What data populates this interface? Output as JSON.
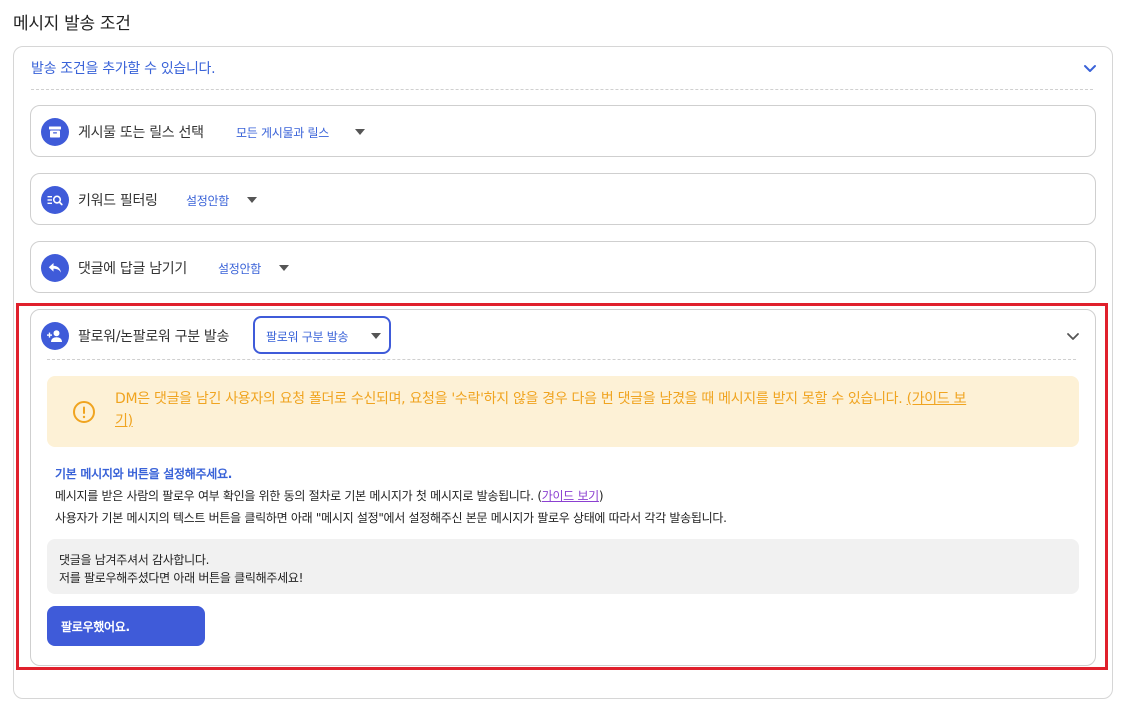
{
  "page_title": "메시지 발송 조건",
  "add_condition": {
    "label": "발송 조건을 추가할 수 있습니다."
  },
  "conditions": [
    {
      "title": "게시물 또는 릴스 선택",
      "value": "모든 게시물과 릴스",
      "icon": "archive-box-icon"
    },
    {
      "title": "키워드 필터링",
      "value": "설정안함",
      "icon": "keyword-search-icon"
    },
    {
      "title": "댓글에 답글 남기기",
      "value": "설정안함",
      "icon": "reply-arrow-icon"
    }
  ],
  "follower_section": {
    "title": "팔로워/논팔로워 구분 발송",
    "select_value": "팔로워 구분 발송",
    "icon": "person-add-icon",
    "warning": {
      "text": "DM은 댓글을 남긴 사용자의 요청 폴더로 수신되며, 요청을 '수락'하지 않을 경우 다음 번 댓글을 남겼을 때 메시지를 받지 못할 수 있습니다. ",
      "link_part1": "(가이드 보",
      "link_part2": "기)"
    },
    "info": {
      "title": "기본 메시지와 버튼을 설정해주세요.",
      "line1_prefix": "메시지를 받은 사람의 팔로우 여부 확인을 위한 동의 절차로 기본 메시지가 첫 메시지로 발송됩니다. (",
      "line1_link": "가이드 보기",
      "line1_suffix": ")",
      "line2": "사용자가 기본 메시지의 텍스트 버튼을 클릭하면 아래 \"메시지 설정\"에서 설정해주신 본문 메시지가 팔로우 상태에 따라서 각각 발송됩니다."
    },
    "message_lines": [
      "댓글을 남겨주셔서 감사합니다.",
      "저를 팔로우해주셨다면 아래 버튼을 클릭해주세요!"
    ],
    "button_label": "팔로우했어요."
  },
  "colors": {
    "accent": "#3f5bd9",
    "link": "#3a63d8",
    "warning_bg": "#fdf1d6",
    "warning_text": "#f0a420",
    "highlight": "#e0202c"
  }
}
